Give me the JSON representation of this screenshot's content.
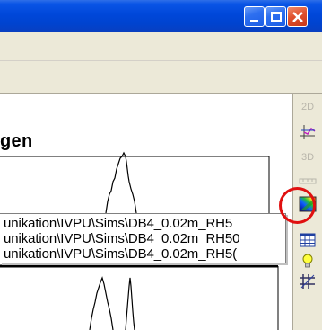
{
  "window": {
    "minimize_label": "",
    "maximize_label": "",
    "close_label": ""
  },
  "chart": {
    "title": "gen"
  },
  "side_toolbar": {
    "items": [
      {
        "label": "2D",
        "icon": "2d-view-icon",
        "enabled": false
      },
      {
        "label": "",
        "icon": "chart-axis-icon",
        "enabled": true
      },
      {
        "label": "3D",
        "icon": "3d-view-icon",
        "enabled": false
      },
      {
        "label": "",
        "icon": "ruler-icon",
        "enabled": false
      },
      {
        "label": "",
        "icon": "color-map-icon",
        "enabled": true
      },
      {
        "label": "",
        "icon": "table-icon",
        "enabled": true
      },
      {
        "label": "",
        "icon": "lightbulb-icon",
        "enabled": true
      },
      {
        "label": "",
        "icon": "grid-hatch-icon",
        "enabled": true
      }
    ]
  },
  "file_list": {
    "rows": [
      "unikation\\IVPU\\Sims\\DB4_0.02m_RH5",
      "unikation\\IVPU\\Sims\\DB4_0.02m_RH50",
      "unikation\\IVPU\\Sims\\DB4_0.02m_RH5("
    ]
  },
  "colors": {
    "titlebar": "#0047d9",
    "highlight_circle": "#e01010"
  }
}
